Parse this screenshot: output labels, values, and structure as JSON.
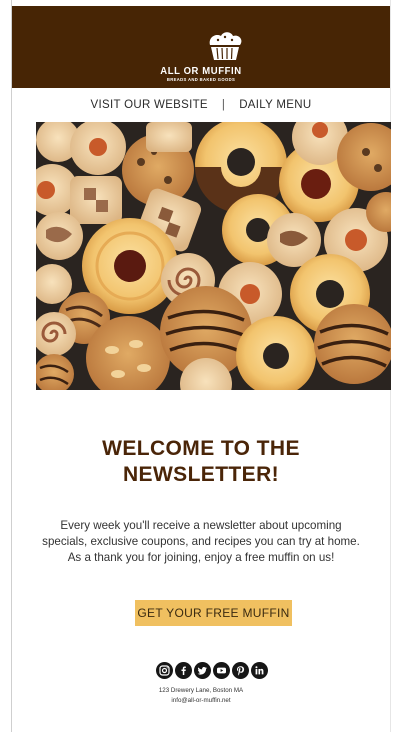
{
  "brand": {
    "name": "ALL OR MUFFIN",
    "tagline": "BREADS AND BAKED GOODS",
    "logo_icon": "muffin-icon",
    "header_color": "#472505"
  },
  "nav": {
    "items": [
      {
        "label": "VISIT OUR WEBSITE"
      },
      {
        "label": "DAILY MENU"
      }
    ],
    "separator": "|"
  },
  "hero": {
    "icon": "cookies-photo"
  },
  "headline": {
    "line1": "WELCOME TO THE",
    "line2": "NEWSLETTER!",
    "color": "#4a2508"
  },
  "body": {
    "line1": "Every week you'll receive a newsletter about upcoming",
    "line2": "specials, exclusive coupons, and recipes you can try at home.",
    "line3": "As a thank you for joining, enjoy a free muffin on us!"
  },
  "cta": {
    "label": "GET YOUR FREE MUFFIN",
    "color": "#f0c060"
  },
  "social": {
    "icons": [
      "instagram-icon",
      "facebook-icon",
      "twitter-icon",
      "youtube-icon",
      "pinterest-icon",
      "linkedin-icon"
    ]
  },
  "footer": {
    "address": "123 Drewery Lane, Boston MA",
    "email": "info@all-or-muffin.net"
  }
}
